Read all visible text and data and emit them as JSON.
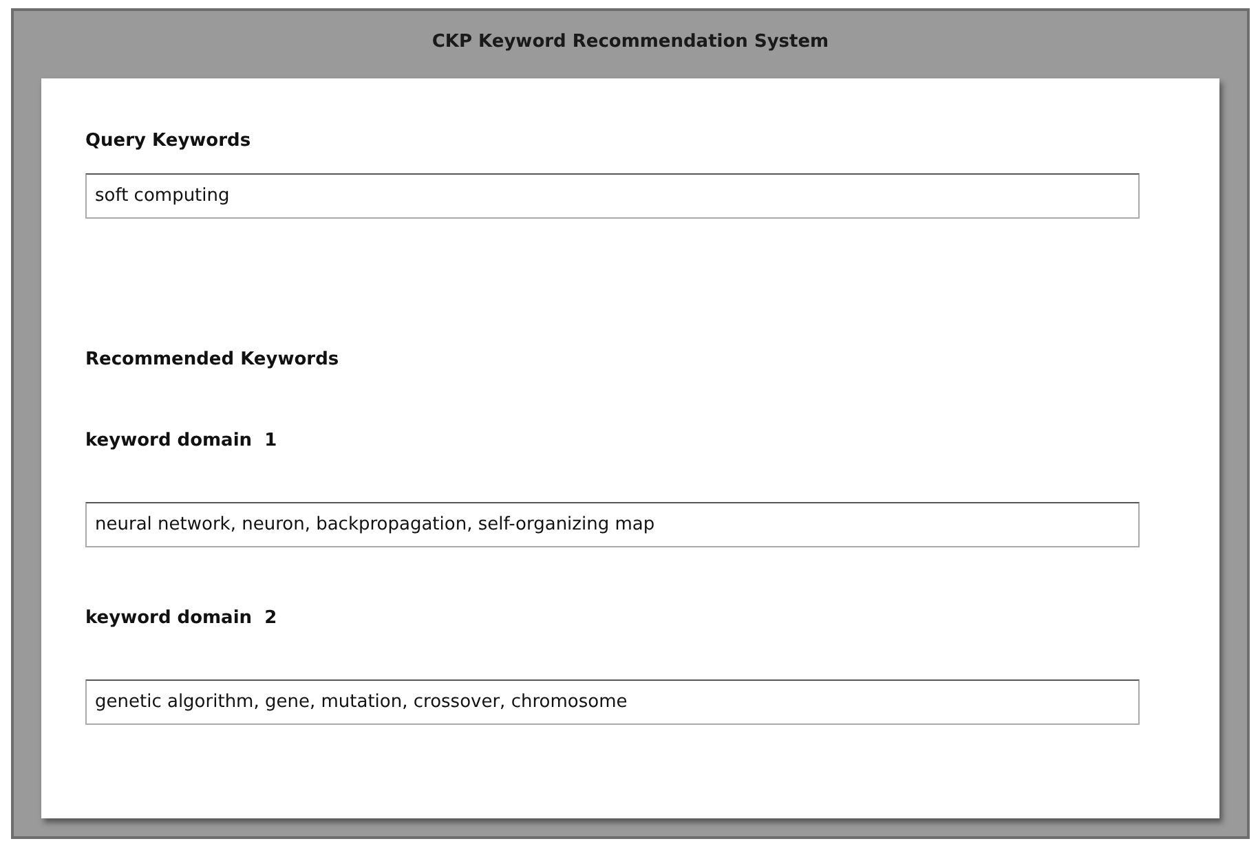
{
  "window": {
    "title": "CKP Keyword Recommendation System"
  },
  "query": {
    "label": "Query Keywords",
    "value": "soft computing"
  },
  "recommended": {
    "heading": "Recommended Keywords",
    "domains": [
      {
        "label": "keyword domain  1",
        "value": "neural network, neuron, backpropagation, self-organizing map"
      },
      {
        "label": "keyword domain  2",
        "value": "genetic algorithm, gene, mutation, crossover, chromosome"
      }
    ]
  }
}
